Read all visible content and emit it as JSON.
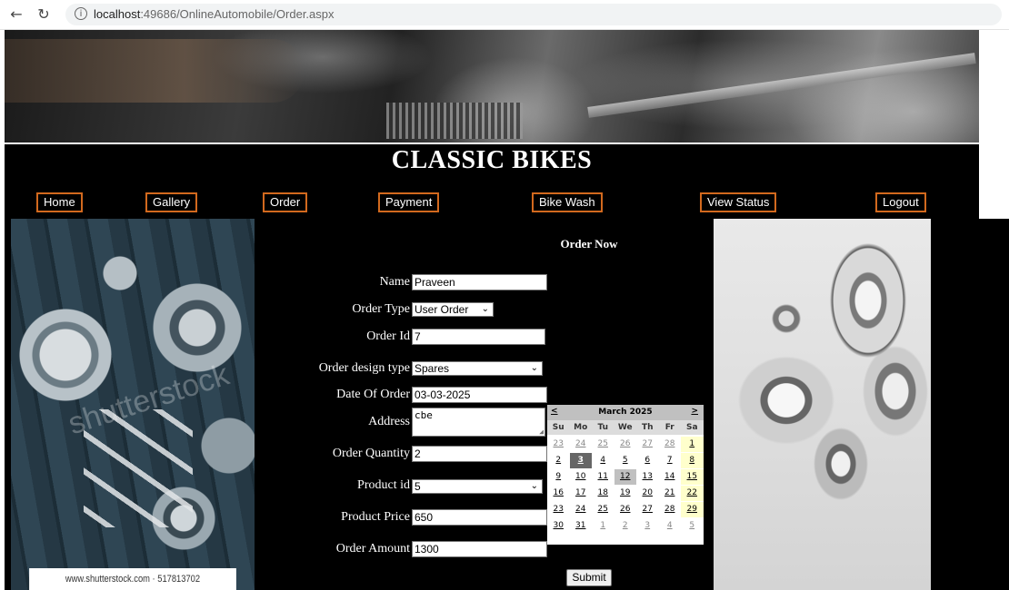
{
  "browser": {
    "back_icon": "arrow-left-icon",
    "reload_icon": "reload-icon",
    "url_host": "localhost",
    "url_rest": ":49686/OnlineAutomobile/Order.aspx"
  },
  "header": {
    "title": "CLASSIC BIKES"
  },
  "nav": {
    "home": "Home",
    "gallery": "Gallery",
    "order": "Order",
    "payment": "Payment",
    "bike_wash": "Bike Wash",
    "view_status": "View Status",
    "logout": "Logout"
  },
  "left_image": {
    "watermark": "shutterstock",
    "caption": "www.shutterstock.com · 517813702"
  },
  "form": {
    "title": "Order Now",
    "name_label": "Name",
    "name_value": "Praveen",
    "order_type_label": "Order Type",
    "order_type_value": "User Order",
    "order_id_label": "Order Id",
    "order_id_value": "7",
    "design_type_label": "Order design type",
    "design_type_value": "Spares",
    "date_label": "Date Of Order",
    "date_value": "03-03-2025",
    "address_label": "Address",
    "address_value": "cbe",
    "quantity_label": "Order Quantity",
    "quantity_value": "2",
    "product_id_label": "Product id",
    "product_id_value": "5",
    "price_label": "Product Price",
    "price_value": "650",
    "amount_label": "Order Amount",
    "amount_value": "1300",
    "submit_label": "Submit"
  },
  "calendar": {
    "prev": "<",
    "next": ">",
    "month": "March 2025",
    "weekdays": [
      "Su",
      "Mo",
      "Tu",
      "We",
      "Th",
      "Fr",
      "Sa"
    ],
    "weeks": [
      [
        "23",
        "24",
        "25",
        "26",
        "27",
        "28",
        "1"
      ],
      [
        "2",
        "3",
        "4",
        "5",
        "6",
        "7",
        "8"
      ],
      [
        "9",
        "10",
        "11",
        "12",
        "13",
        "14",
        "15"
      ],
      [
        "16",
        "17",
        "18",
        "19",
        "20",
        "21",
        "22"
      ],
      [
        "23",
        "24",
        "25",
        "26",
        "27",
        "28",
        "29"
      ],
      [
        "30",
        "31",
        "1",
        "2",
        "3",
        "4",
        "5"
      ]
    ],
    "selected_day": "3",
    "today": "12"
  }
}
